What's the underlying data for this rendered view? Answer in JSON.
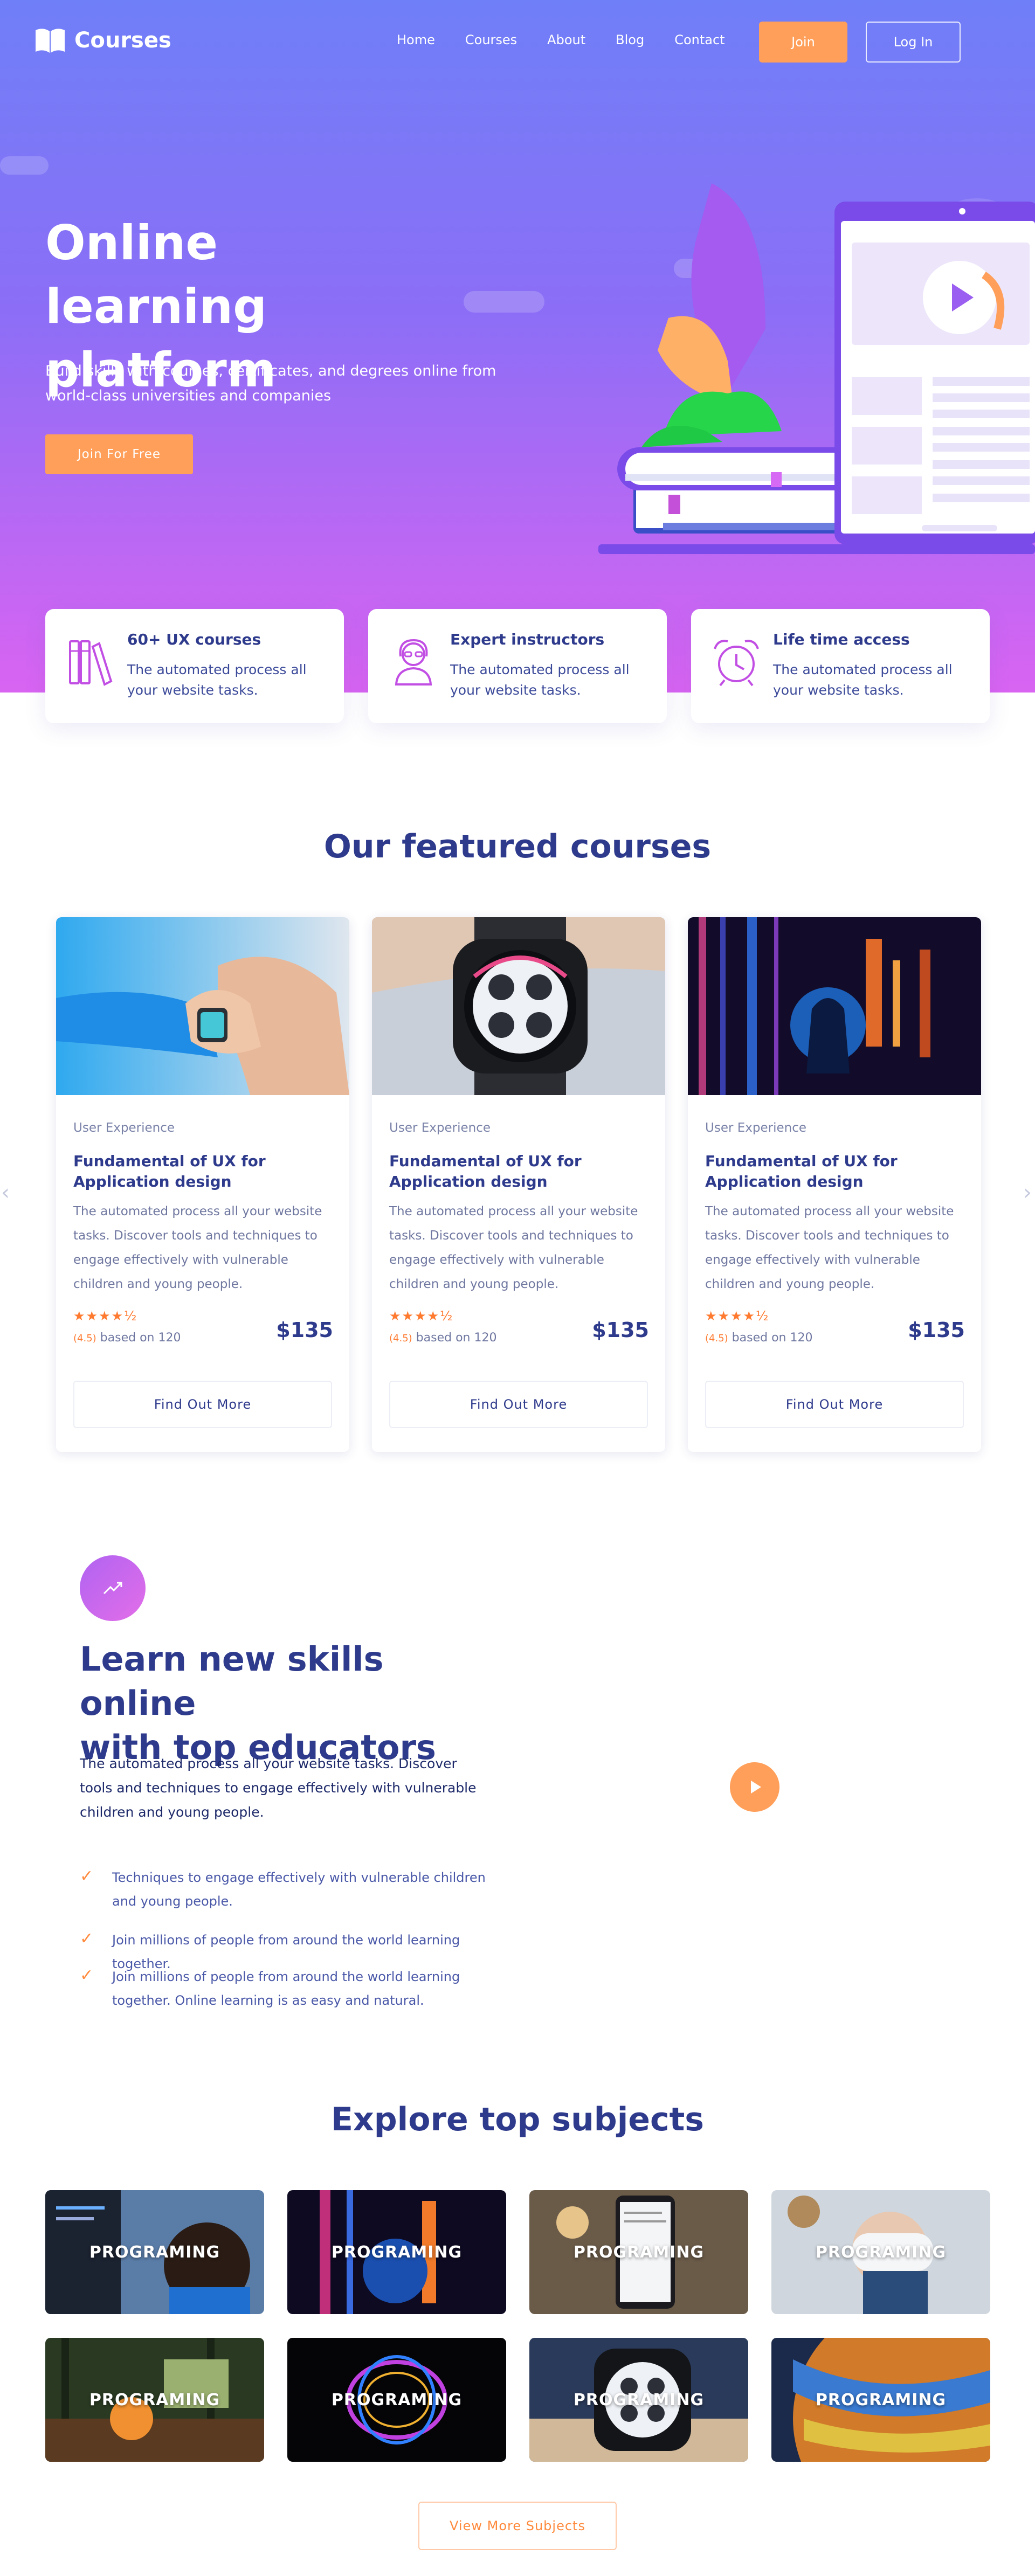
{
  "nav": {
    "logo_text": "Courses",
    "items": [
      "Home",
      "Courses",
      "About",
      "Blog",
      "Contact"
    ],
    "join": "Join",
    "login": "Log In"
  },
  "hero": {
    "title_line1": "Online learning",
    "title_line2": "platform",
    "subtitle": "Build skills with courses, certificates, and degrees online from world-class universities and companies",
    "cta": "Join For Free"
  },
  "features": [
    {
      "title": "60+ UX courses",
      "desc": "The automated process all your website tasks.",
      "icon": "books-icon"
    },
    {
      "title": "Expert instructors",
      "desc": "The automated process all your website tasks.",
      "icon": "instructor-icon"
    },
    {
      "title": "Life time access",
      "desc": "The automated process all your website tasks.",
      "icon": "alarm-clock-icon"
    }
  ],
  "featured": {
    "title": "Our featured courses",
    "cards": [
      {
        "category": "User Experience",
        "title": "Fundamental of UX for Application design",
        "desc": "The automated process all your website tasks. Discover tools and techniques to engage effectively with vulnerable children and young people.",
        "stars": "★★★★½",
        "rating_value": "(4.5)",
        "rating_text": " based on 120",
        "price": "$135",
        "button": "Find Out More"
      },
      {
        "category": "User Experience",
        "title": "Fundamental of UX for Application design",
        "desc": "The automated process all your website tasks. Discover tools and techniques to engage effectively with vulnerable children and young people.",
        "stars": "★★★★½",
        "rating_value": "(4.5)",
        "rating_text": " based on 120",
        "price": "$135",
        "button": "Find Out More"
      },
      {
        "category": "User Experience",
        "title": "Fundamental of UX for Application design",
        "desc": "The automated process all your website tasks. Discover tools and techniques to engage effectively with vulnerable children and young people.",
        "stars": "★★★★½",
        "rating_value": "(4.5)",
        "rating_text": " based on 120",
        "price": "$135",
        "button": "Find Out More"
      }
    ],
    "prev_arrow": "‹",
    "next_arrow": "›"
  },
  "learn": {
    "title_line1": "Learn new skills online",
    "title_line2": "with top educators",
    "desc": "The automated process all your website tasks. Discover tools and techniques to engage effectively with vulnerable children and young people.",
    "checks": [
      "Techniques to engage effectively with vulnerable children and young people.",
      "Join millions of people from around the world learning together.",
      "Join millions of people from around the world learning together. Online learning is as easy and natural."
    ],
    "tick": "✓"
  },
  "subjects": {
    "title": "Explore top subjects",
    "tiles": [
      "PROGRAMING",
      "PROGRAMING",
      "PROGRAMING",
      "PROGRAMING",
      "PROGRAMING",
      "PROGRAMING",
      "PROGRAMING",
      "PROGRAMING"
    ],
    "more": "View More Subjects"
  },
  "colors": {
    "accent": "#ff9f5a",
    "primary_text": "#2e3a8c",
    "hero_gradient_top": "#6f7ff7",
    "hero_gradient_bottom": "#d964f2"
  }
}
